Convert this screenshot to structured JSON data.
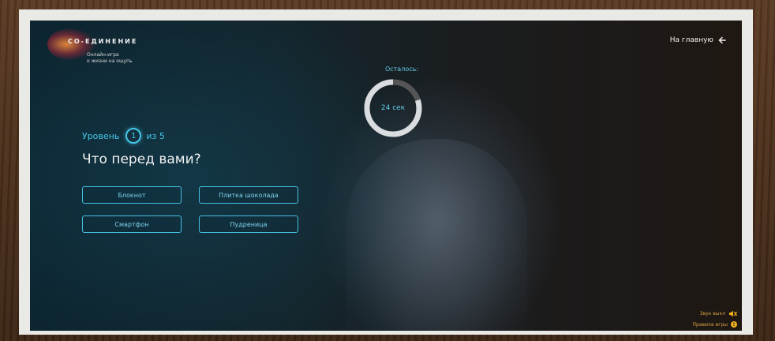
{
  "brand": {
    "title": "СО-ЕДИНЕНИЕ",
    "subtitle_line1": "Онлайн-игра",
    "subtitle_line2": "о жизни на ощупь"
  },
  "nav": {
    "home_label": "На главную"
  },
  "timer": {
    "label": "Осталось:",
    "value_text": "24 сек",
    "remaining_fraction": 0.8,
    "ring_color": "#d9dde0",
    "ring_track_color": "#555555"
  },
  "level": {
    "prefix": "Уровень",
    "current": "1",
    "suffix": "из 5"
  },
  "question": "Что перед вами?",
  "answers": [
    {
      "label": "Блокнот"
    },
    {
      "label": "Плитка шоколада"
    },
    {
      "label": "Смартфон"
    },
    {
      "label": "Пудреница"
    }
  ],
  "footer": {
    "sound_label": "Звук выкл",
    "rules_label": "Правила игры"
  },
  "colors": {
    "accent": "#46c6e8",
    "footer_text": "#d8a246"
  },
  "icons": [
    "arrow-left-icon",
    "sound-off-icon",
    "info-icon"
  ]
}
